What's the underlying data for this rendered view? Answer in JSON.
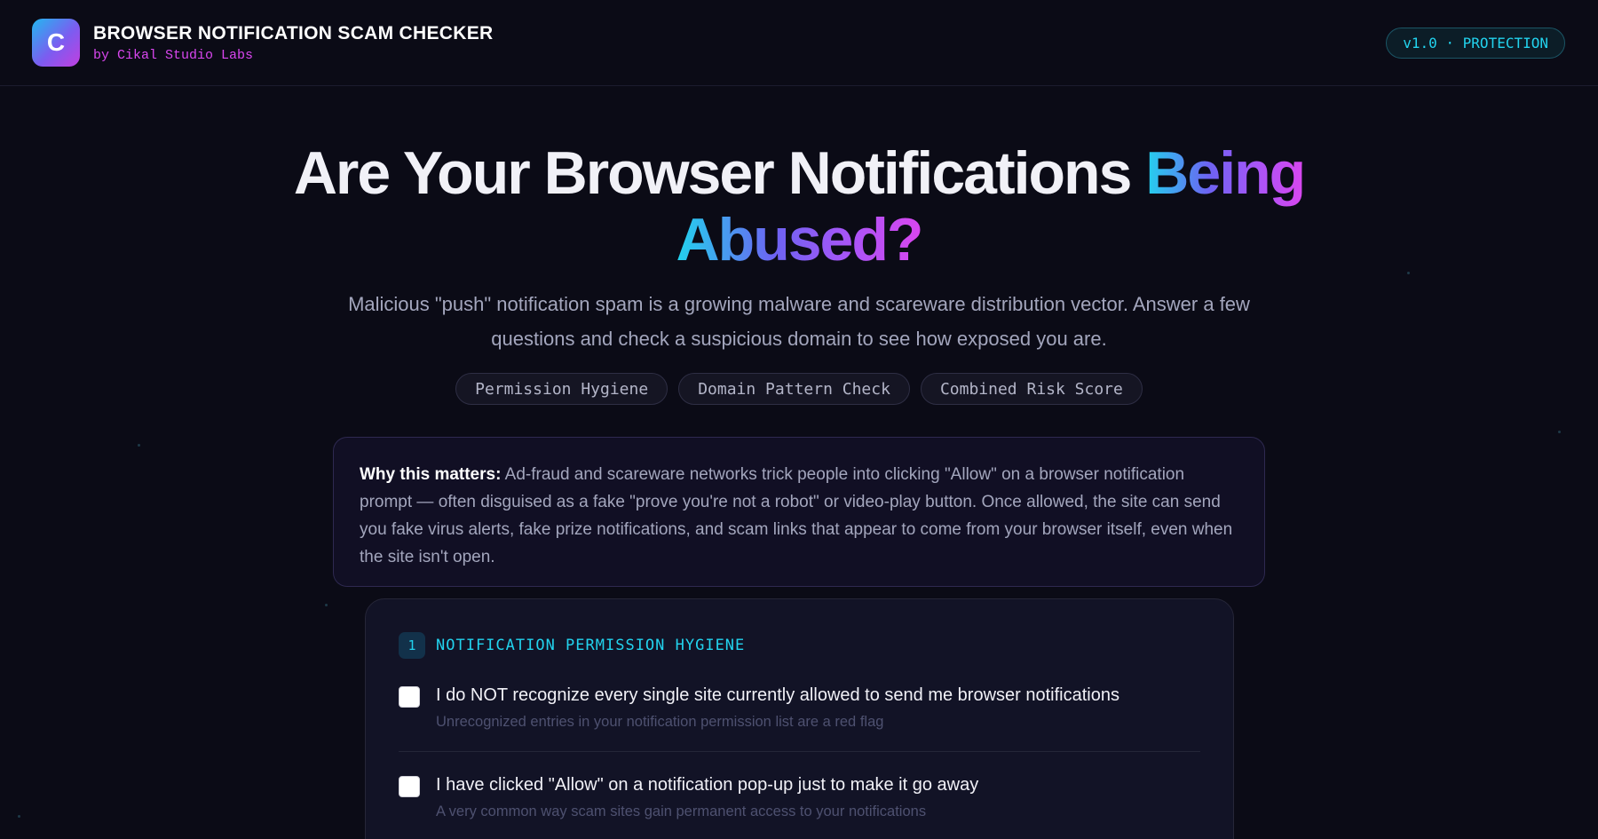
{
  "header": {
    "logo_letter": "C",
    "title": "BROWSER NOTIFICATION SCAM CHECKER",
    "subtitle": "by Cikal Studio Labs",
    "version_badge": "v1.0 · PROTECTION"
  },
  "hero": {
    "title_plain": "Are Your Browser Notifications ",
    "title_gradient_1": "Being",
    "title_gradient_2": "Abused?",
    "subtitle": "Malicious \"push\" notification spam is a growing malware and scareware distribution vector. Answer a few questions and check a suspicious domain to see how exposed you are.",
    "pills": [
      "Permission Hygiene",
      "Domain Pattern Check",
      "Combined Risk Score"
    ]
  },
  "why": {
    "label": "Why this matters:",
    "text": " Ad-fraud and scareware networks trick people into clicking \"Allow\" on a browser notification prompt — often disguised as a fake \"prove you're not a robot\" or video-play button. Once allowed, the site can send you fake virus alerts, fake prize notifications, and scam links that appear to come from your browser itself, even when the site isn't open."
  },
  "section1": {
    "number": "1",
    "title": "NOTIFICATION PERMISSION HYGIENE",
    "items": [
      {
        "label": "I do NOT recognize every single site currently allowed to send me browser notifications",
        "hint": "Unrecognized entries in your notification permission list are a red flag",
        "checked": false
      },
      {
        "label": "I have clicked \"Allow\" on a notification pop-up just to make it go away",
        "hint": "A very common way scam sites gain permanent access to your notifications",
        "checked": false
      }
    ]
  },
  "colors": {
    "background": "#0b0b16",
    "accent_cyan": "#22d3ee",
    "accent_magenta": "#d946ef",
    "accent_violet": "#7c5cf0"
  }
}
